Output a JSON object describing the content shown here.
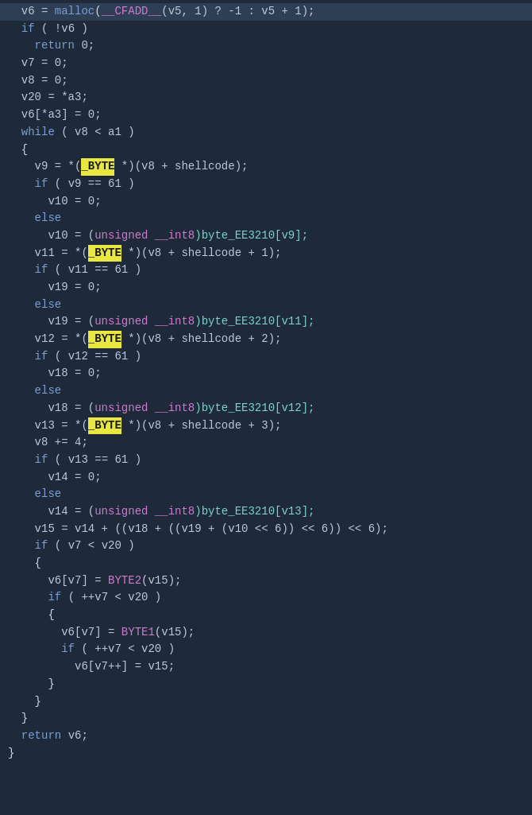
{
  "code": {
    "lines": [
      {
        "id": 1,
        "highlight": true,
        "tokens": [
          {
            "t": "  v6 = ",
            "c": "var"
          },
          {
            "t": "malloc",
            "c": "fn"
          },
          {
            "t": "(",
            "c": "bracket"
          },
          {
            "t": "__CFADD__",
            "c": "macro"
          },
          {
            "t": "(v5, 1) ? -1 : v5 + 1);",
            "c": "var"
          }
        ]
      },
      {
        "id": 2,
        "highlight": false,
        "tokens": [
          {
            "t": "  ",
            "c": ""
          },
          {
            "t": "if",
            "c": "kw"
          },
          {
            "t": " ( !v6 )",
            "c": "var"
          }
        ]
      },
      {
        "id": 3,
        "highlight": false,
        "tokens": [
          {
            "t": "    ",
            "c": ""
          },
          {
            "t": "return",
            "c": "kw"
          },
          {
            "t": " 0;",
            "c": "var"
          }
        ]
      },
      {
        "id": 4,
        "highlight": false,
        "tokens": [
          {
            "t": "  v7 = 0;",
            "c": "var"
          }
        ]
      },
      {
        "id": 5,
        "highlight": false,
        "tokens": [
          {
            "t": "  v8 = 0;",
            "c": "var"
          }
        ]
      },
      {
        "id": 6,
        "highlight": false,
        "tokens": [
          {
            "t": "  v20 = *a3;",
            "c": "var"
          }
        ]
      },
      {
        "id": 7,
        "highlight": false,
        "tokens": [
          {
            "t": "  v6[*a3] = 0;",
            "c": "var"
          }
        ]
      },
      {
        "id": 8,
        "highlight": false,
        "tokens": [
          {
            "t": "  ",
            "c": ""
          },
          {
            "t": "while",
            "c": "kw"
          },
          {
            "t": " ( v8 < a1 )",
            "c": "var"
          }
        ]
      },
      {
        "id": 9,
        "highlight": false,
        "tokens": [
          {
            "t": "  {",
            "c": "bracket"
          }
        ]
      },
      {
        "id": 10,
        "highlight": false,
        "tokens": [
          {
            "t": "    v9 = *(",
            "c": "var"
          },
          {
            "t": "_BYTE",
            "c": "hl-byte"
          },
          {
            "t": " *)(v8 + shellcode);",
            "c": "var"
          }
        ]
      },
      {
        "id": 11,
        "highlight": false,
        "tokens": [
          {
            "t": "    ",
            "c": ""
          },
          {
            "t": "if",
            "c": "kw"
          },
          {
            "t": " ( v9 == 61 )",
            "c": "var"
          }
        ]
      },
      {
        "id": 12,
        "highlight": false,
        "tokens": [
          {
            "t": "      v10 = 0;",
            "c": "var"
          }
        ]
      },
      {
        "id": 13,
        "highlight": false,
        "tokens": [
          {
            "t": "    ",
            "c": ""
          },
          {
            "t": "else",
            "c": "kw"
          }
        ]
      },
      {
        "id": 14,
        "highlight": false,
        "tokens": [
          {
            "t": "      v10 = (",
            "c": "var"
          },
          {
            "t": "unsigned __int8",
            "c": "type"
          },
          {
            "t": ")byte_EE3210[v9];",
            "c": "teal"
          }
        ]
      },
      {
        "id": 15,
        "highlight": false,
        "tokens": [
          {
            "t": "    v11 = *(",
            "c": "var"
          },
          {
            "t": "_BYTE",
            "c": "hl-byte"
          },
          {
            "t": " *)(v8 + shellcode + 1);",
            "c": "var"
          }
        ]
      },
      {
        "id": 16,
        "highlight": false,
        "tokens": [
          {
            "t": "    ",
            "c": ""
          },
          {
            "t": "if",
            "c": "kw"
          },
          {
            "t": " ( v11 == 61 )",
            "c": "var"
          }
        ]
      },
      {
        "id": 17,
        "highlight": false,
        "tokens": [
          {
            "t": "      v19 = 0;",
            "c": "var"
          }
        ]
      },
      {
        "id": 18,
        "highlight": false,
        "tokens": [
          {
            "t": "    ",
            "c": ""
          },
          {
            "t": "else",
            "c": "kw"
          }
        ]
      },
      {
        "id": 19,
        "highlight": false,
        "tokens": [
          {
            "t": "      v19 = (",
            "c": "var"
          },
          {
            "t": "unsigned __int8",
            "c": "type"
          },
          {
            "t": ")byte_EE3210[v11];",
            "c": "teal"
          }
        ]
      },
      {
        "id": 20,
        "highlight": false,
        "tokens": [
          {
            "t": "    v12 = *(",
            "c": "var"
          },
          {
            "t": "_BYTE",
            "c": "hl-byte"
          },
          {
            "t": " *)(v8 + shellcode + 2);",
            "c": "var"
          }
        ]
      },
      {
        "id": 21,
        "highlight": false,
        "tokens": [
          {
            "t": "    ",
            "c": ""
          },
          {
            "t": "if",
            "c": "kw"
          },
          {
            "t": " ( v12 == 61 )",
            "c": "var"
          }
        ]
      },
      {
        "id": 22,
        "highlight": false,
        "tokens": [
          {
            "t": "      v18 = 0;",
            "c": "var"
          }
        ]
      },
      {
        "id": 23,
        "highlight": false,
        "tokens": [
          {
            "t": "    ",
            "c": ""
          },
          {
            "t": "else",
            "c": "kw"
          }
        ]
      },
      {
        "id": 24,
        "highlight": false,
        "tokens": [
          {
            "t": "      v18 = (",
            "c": "var"
          },
          {
            "t": "unsigned __int8",
            "c": "type"
          },
          {
            "t": ")byte_EE3210[v12];",
            "c": "teal"
          }
        ]
      },
      {
        "id": 25,
        "highlight": false,
        "tokens": [
          {
            "t": "    v13 = *(",
            "c": "var"
          },
          {
            "t": "_BYTE",
            "c": "hl-byte"
          },
          {
            "t": " *)(v8 + shellcode + 3);",
            "c": "var"
          }
        ]
      },
      {
        "id": 26,
        "highlight": false,
        "tokens": [
          {
            "t": "    v8 += 4;",
            "c": "var"
          }
        ]
      },
      {
        "id": 27,
        "highlight": false,
        "tokens": [
          {
            "t": "    ",
            "c": ""
          },
          {
            "t": "if",
            "c": "kw"
          },
          {
            "t": " ( v13 == 61 )",
            "c": "var"
          }
        ]
      },
      {
        "id": 28,
        "highlight": false,
        "tokens": [
          {
            "t": "      v14 = 0;",
            "c": "var"
          }
        ]
      },
      {
        "id": 29,
        "highlight": false,
        "tokens": [
          {
            "t": "    ",
            "c": ""
          },
          {
            "t": "else",
            "c": "kw"
          }
        ]
      },
      {
        "id": 30,
        "highlight": false,
        "tokens": [
          {
            "t": "      v14 = (",
            "c": "var"
          },
          {
            "t": "unsigned __int8",
            "c": "type"
          },
          {
            "t": ")byte_EE3210[v13];",
            "c": "teal"
          }
        ]
      },
      {
        "id": 31,
        "highlight": false,
        "tokens": [
          {
            "t": "    v15 = v14 + ((v18 + ((v19 + (v10 << 6)) << 6)) << 6);",
            "c": "var"
          }
        ]
      },
      {
        "id": 32,
        "highlight": false,
        "tokens": [
          {
            "t": "    ",
            "c": ""
          },
          {
            "t": "if",
            "c": "kw"
          },
          {
            "t": " ( v7 < v20 )",
            "c": "var"
          }
        ]
      },
      {
        "id": 33,
        "highlight": false,
        "tokens": [
          {
            "t": "    {",
            "c": "bracket"
          }
        ]
      },
      {
        "id": 34,
        "highlight": false,
        "tokens": [
          {
            "t": "      v6[v7] = ",
            "c": "var"
          },
          {
            "t": "BYTE2",
            "c": "macro"
          },
          {
            "t": "(v15);",
            "c": "var"
          }
        ]
      },
      {
        "id": 35,
        "highlight": false,
        "tokens": [
          {
            "t": "      ",
            "c": ""
          },
          {
            "t": "if",
            "c": "kw"
          },
          {
            "t": " ( ++v7 < v20 )",
            "c": "var"
          }
        ]
      },
      {
        "id": 36,
        "highlight": false,
        "tokens": [
          {
            "t": "      {",
            "c": "bracket"
          }
        ]
      },
      {
        "id": 37,
        "highlight": false,
        "tokens": [
          {
            "t": "        v6[v7] = ",
            "c": "var"
          },
          {
            "t": "BYTE1",
            "c": "macro"
          },
          {
            "t": "(v15);",
            "c": "var"
          }
        ]
      },
      {
        "id": 38,
        "highlight": false,
        "tokens": [
          {
            "t": "        ",
            "c": ""
          },
          {
            "t": "if",
            "c": "kw"
          },
          {
            "t": " ( ++v7 < v20 )",
            "c": "var"
          }
        ]
      },
      {
        "id": 39,
        "highlight": false,
        "tokens": [
          {
            "t": "          v6[v7++] = v15;",
            "c": "var"
          }
        ]
      },
      {
        "id": 40,
        "highlight": false,
        "tokens": [
          {
            "t": "      }",
            "c": "bracket"
          }
        ]
      },
      {
        "id": 41,
        "highlight": false,
        "tokens": [
          {
            "t": "    }",
            "c": "bracket"
          }
        ]
      },
      {
        "id": 42,
        "highlight": false,
        "tokens": [
          {
            "t": "  }",
            "c": "bracket"
          }
        ]
      },
      {
        "id": 43,
        "highlight": false,
        "tokens": [
          {
            "t": "  ",
            "c": ""
          },
          {
            "t": "return",
            "c": "kw"
          },
          {
            "t": " v6;",
            "c": "var"
          }
        ]
      },
      {
        "id": 44,
        "highlight": false,
        "tokens": [
          {
            "t": "}",
            "c": "bracket"
          }
        ]
      }
    ]
  }
}
